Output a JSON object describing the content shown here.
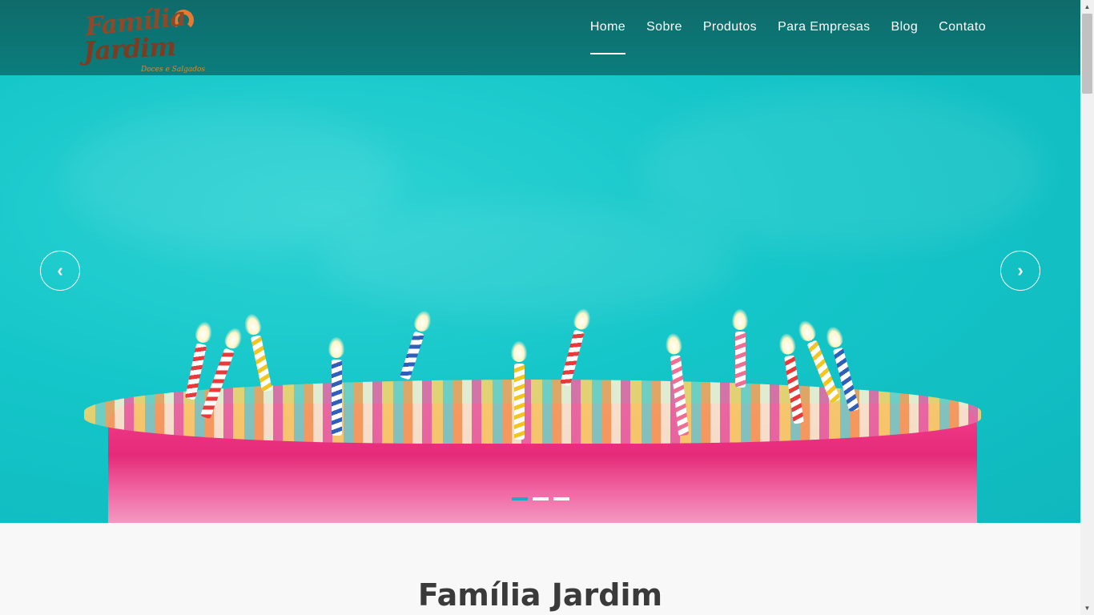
{
  "brand": {
    "logo_line1": "Família",
    "logo_line2": "Jardim",
    "logo_tagline": "Doces e Salgados"
  },
  "nav": {
    "items": [
      {
        "label": "Home",
        "active": true
      },
      {
        "label": "Sobre"
      },
      {
        "label": "Produtos"
      },
      {
        "label": "Para Empresas"
      },
      {
        "label": "Blog"
      },
      {
        "label": "Contato"
      }
    ]
  },
  "slider": {
    "prev_icon": "chevron-left-icon",
    "next_icon": "chevron-right-icon",
    "prev_glyph": "‹",
    "next_glyph": "›",
    "slide_count": 3,
    "active_slide": 1
  },
  "main": {
    "heading": "Família Jardim"
  },
  "colors": {
    "header_bg": "#0a7d7c",
    "hero_bg": "#14c6c9",
    "active_dot": "#1fa9c9",
    "heading_text": "#3a3a3a"
  }
}
